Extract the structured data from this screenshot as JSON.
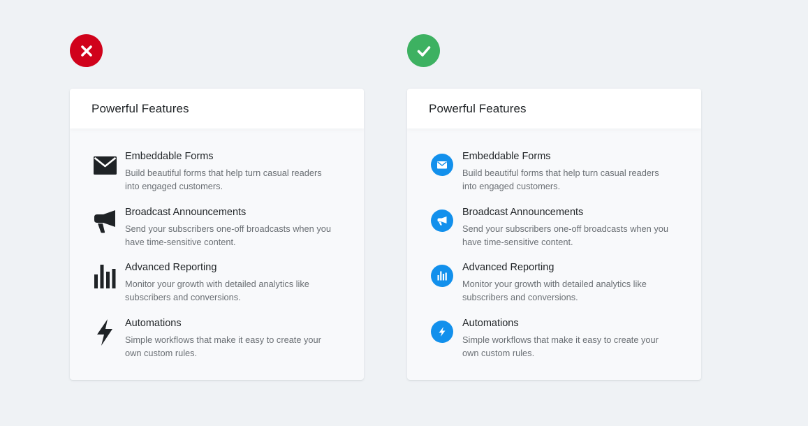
{
  "colors": {
    "bad": "#d0021b",
    "good": "#3db161",
    "accent_blue": "#1290ec",
    "dark_icon": "#1f2326"
  },
  "comparison": {
    "bad_indicator_icon": "x-icon",
    "good_indicator_icon": "check-icon"
  },
  "left_card": {
    "title": "Powerful Features",
    "features": [
      {
        "icon": "envelope-icon",
        "title": "Embeddable Forms",
        "description": "Build beautiful forms that help turn casual readers into engaged customers."
      },
      {
        "icon": "megaphone-icon",
        "title": "Broadcast Announcements",
        "description": "Send your subscribers one-off broadcasts when you have time-sensitive content."
      },
      {
        "icon": "bar-chart-icon",
        "title": "Advanced Reporting",
        "description": "Monitor your growth with detailed analytics like subscribers and conversions."
      },
      {
        "icon": "lightning-icon",
        "title": "Automations",
        "description": "Simple workflows that make it easy to create your own custom rules."
      }
    ]
  },
  "right_card": {
    "title": "Powerful Features",
    "features": [
      {
        "icon": "envelope-icon",
        "title": "Embeddable Forms",
        "description": "Build beautiful forms that help turn casual readers into engaged customers."
      },
      {
        "icon": "megaphone-icon",
        "title": "Broadcast Announcements",
        "description": "Send your subscribers one-off broadcasts when you have time-sensitive content."
      },
      {
        "icon": "bar-chart-icon",
        "title": "Advanced Reporting",
        "description": "Monitor your growth with detailed analytics like subscribers and conversions."
      },
      {
        "icon": "lightning-icon",
        "title": "Automations",
        "description": "Simple workflows that make it easy to create your own custom rules."
      }
    ]
  }
}
